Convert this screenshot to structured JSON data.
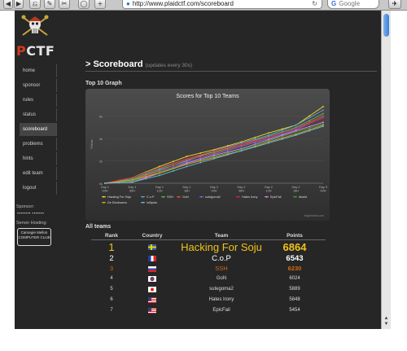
{
  "browser": {
    "url": "http://www.plaidctf.com/scoreboard",
    "search_placeholder": "Google",
    "nav_buttons": [
      "◀",
      "▶"
    ],
    "reload_glyph": "↻"
  },
  "logo": {
    "text_prefix": "P",
    "text_rest": "CTF"
  },
  "nav": {
    "items": [
      {
        "label": "home",
        "active": false
      },
      {
        "label": "sponsor",
        "active": false
      },
      {
        "label": "rules",
        "active": false
      },
      {
        "label": "status",
        "active": false
      },
      {
        "label": "scoreboard",
        "active": true
      },
      {
        "label": "problems",
        "active": false
      },
      {
        "label": "hints",
        "active": false
      },
      {
        "label": "edit team",
        "active": false
      },
      {
        "label": "logout",
        "active": false
      }
    ],
    "sponsor_label": "Sponsor:",
    "sponsor_name": "▪▪▪▪▪▪▪▪ ▪▪▪▪▪▪▪",
    "hosting_label": "Server Hosting:",
    "hosting_name": "Carnegie Mellon COMPUTER CLUB"
  },
  "main": {
    "arrow": ">",
    "title": "Scoreboard",
    "subtitle": "(updates every 30s)",
    "graph_heading": "Top 10 Graph",
    "teams_heading": "All teams"
  },
  "chart_data": {
    "type": "line",
    "title": "Scores for Top 10 Teams",
    "ylabel": "Points",
    "ytick_labels": [
      "6k",
      "4k",
      "2k",
      "0k"
    ],
    "ylim": [
      0,
      7000
    ],
    "x_tick_labels": [
      "Day 1\n00H",
      "Day 1\n06H",
      "Day 1\n12H",
      "Day 1\n18H",
      "Day 2\n00H",
      "Day 2\n06H",
      "Day 2\n12H",
      "Day 2\n18H",
      "Day 3\n00H"
    ],
    "credit": "Highcharts.com",
    "series": [
      {
        "name": "Hacking For Soju",
        "color": "#f0e020",
        "values": [
          0,
          500,
          1500,
          2400,
          3000,
          3700,
          4500,
          5200,
          6864
        ]
      },
      {
        "name": "C.o.P",
        "color": "#6fa0e0",
        "values": [
          0,
          300,
          1200,
          2000,
          2900,
          3600,
          4300,
          5200,
          6543
        ]
      },
      {
        "name": "SSH",
        "color": "#50c050",
        "values": [
          0,
          400,
          1300,
          2200,
          2800,
          3500,
          4200,
          5000,
          6230
        ]
      },
      {
        "name": "GoN",
        "color": "#e05a30",
        "values": [
          0,
          300,
          1100,
          2100,
          2700,
          3400,
          4100,
          4900,
          6024
        ]
      },
      {
        "name": "sutegoma2",
        "color": "#7070e0",
        "values": [
          0,
          200,
          1000,
          1900,
          2600,
          3300,
          4000,
          4800,
          5889
        ]
      },
      {
        "name": "Hates Irony",
        "color": "#e02060",
        "values": [
          0,
          500,
          1400,
          2200,
          2900,
          3500,
          4100,
          4900,
          5848
        ]
      },
      {
        "name": "EpicFail",
        "color": "#f080f0",
        "values": [
          0,
          100,
          900,
          1800,
          2500,
          3100,
          3900,
          4700,
          5454
        ]
      },
      {
        "name": "disekt",
        "color": "#40a040",
        "values": [
          0,
          200,
          1000,
          1700,
          2400,
          3000,
          3800,
          4600,
          5300
        ]
      },
      {
        "name": "De Eindbazen",
        "color": "#e0a020",
        "values": [
          0,
          300,
          900,
          1700,
          2300,
          2900,
          3700,
          4400,
          5200
        ]
      },
      {
        "name": "int3pids",
        "color": "#60c0e0",
        "values": [
          0,
          100,
          700,
          1500,
          2200,
          2900,
          3600,
          4300,
          5100
        ]
      }
    ],
    "legend_position": "bottom"
  },
  "table": {
    "headers": [
      "Rank",
      "Country",
      "Team",
      "Points"
    ],
    "rows": [
      {
        "rank": "1",
        "flag": "se",
        "team": "Hacking For Soju",
        "points": "6864",
        "color": "#f2c21a",
        "size": "large"
      },
      {
        "rank": "2",
        "flag": "fr",
        "team": "C.o.P",
        "points": "6543",
        "color": "#ffffff",
        "size": "medium"
      },
      {
        "rank": "3",
        "flag": "ru",
        "team": "SSH",
        "points": "6230",
        "color": "#d26a10",
        "size": "small"
      },
      {
        "rank": "4",
        "flag": "kr",
        "team": "GoN",
        "points": "6024",
        "color": "#dddddd",
        "size": "tiny"
      },
      {
        "rank": "5",
        "flag": "jp",
        "team": "sutegoma2",
        "points": "5889",
        "color": "#dddddd",
        "size": "tiny"
      },
      {
        "rank": "6",
        "flag": "us",
        "team": "Hates Irony",
        "points": "5848",
        "color": "#dddddd",
        "size": "tiny"
      },
      {
        "rank": "7",
        "flag": "us",
        "team": "EpicFail",
        "points": "5454",
        "color": "#dddddd",
        "size": "tiny"
      }
    ]
  }
}
